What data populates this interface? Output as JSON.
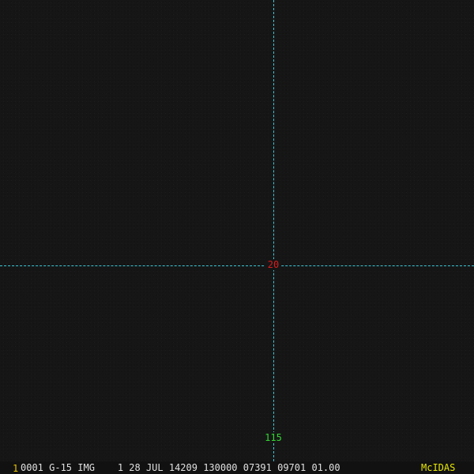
{
  "frame": {
    "number": "1",
    "number_color": "#e6c200"
  },
  "image": {
    "info_line": "0001 G-15 IMG    1 28 JUL 14209 130000 07391 09701 01.00",
    "info_color": "#e0e0e0",
    "branding": "McIDAS",
    "branding_color": "#e8e800"
  },
  "grid": {
    "line_color": "#3cc8d8",
    "latitude_label": "20",
    "latitude_color": "#d81e1e",
    "longitude_label": "115",
    "longitude_color": "#33d833"
  }
}
